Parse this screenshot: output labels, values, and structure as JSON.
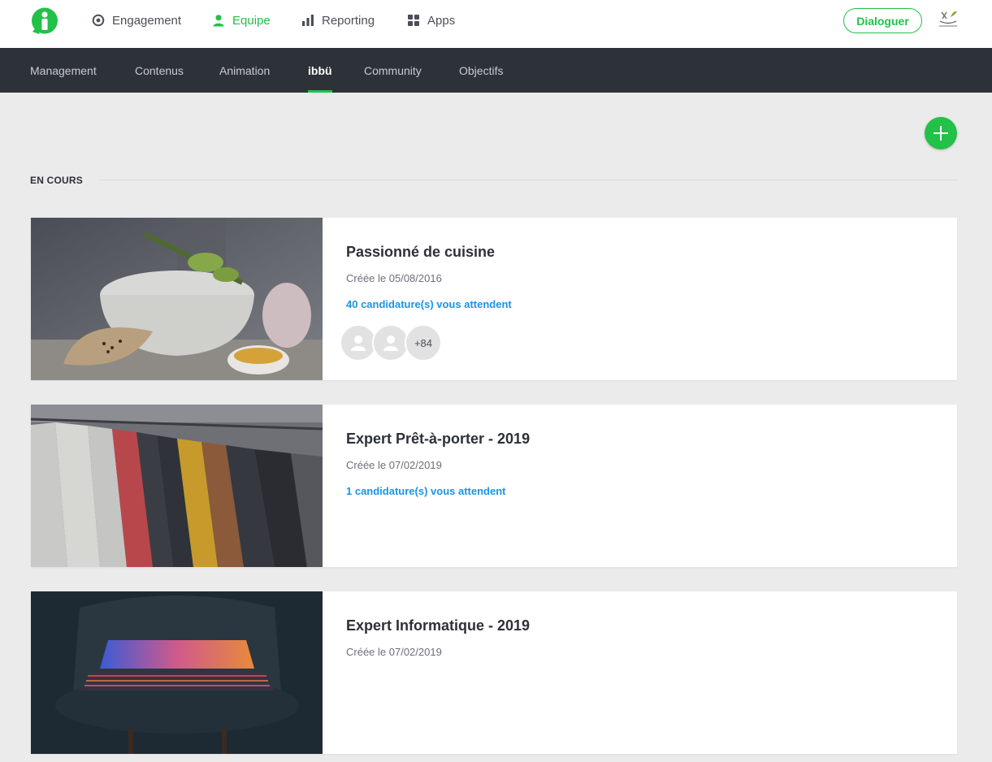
{
  "topbar": {
    "nav": [
      {
        "label": "Engagement",
        "icon": "target-icon",
        "active": false
      },
      {
        "label": "Equipe",
        "icon": "user-icon",
        "active": true
      },
      {
        "label": "Reporting",
        "icon": "bar-chart-icon",
        "active": false
      },
      {
        "label": "Apps",
        "icon": "grid-icon",
        "active": false
      }
    ],
    "dialog_label": "Dialoguer",
    "accent": "#22c147"
  },
  "subnav": {
    "items": [
      {
        "label": "Management",
        "active": false
      },
      {
        "label": "Contenus",
        "active": false
      },
      {
        "label": "Animation",
        "active": false
      },
      {
        "label": "ibbü",
        "active": true
      },
      {
        "label": "Community",
        "active": false
      },
      {
        "label": "Objectifs",
        "active": false
      }
    ]
  },
  "section": {
    "label": "EN COURS"
  },
  "cards": [
    {
      "title": "Passionné de cuisine",
      "date": "Créée le 05/08/2016",
      "applications": "40 candidature(s) vous attendent",
      "avatars_more": "+84",
      "image": "cooking-photo"
    },
    {
      "title": "Expert Prêt-à-porter - 2019",
      "date": "Créée le 07/02/2019",
      "applications": "1 candidature(s) vous attendent",
      "image": "clothes-rack-photo"
    },
    {
      "title": "Expert Informatique - 2019",
      "date": "Créée le 07/02/2019",
      "image": "laptop-photo"
    }
  ]
}
